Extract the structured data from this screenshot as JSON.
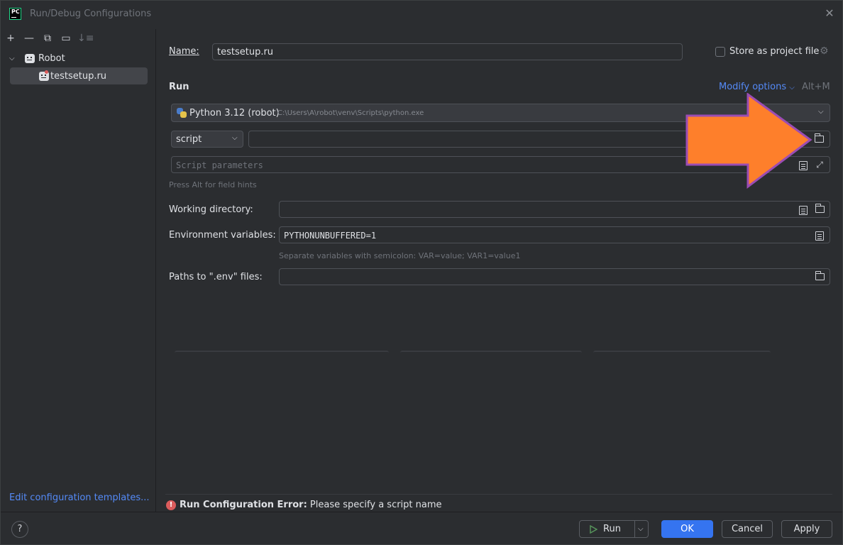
{
  "window": {
    "title": "Run/Debug Configurations",
    "app_logo": "PC"
  },
  "left_panel": {
    "toolbar": [
      "+",
      "—",
      "⧉",
      "▭",
      "↓≡"
    ],
    "tree": {
      "group_label": "Robot",
      "items": [
        {
          "label": "testsetup.ru"
        }
      ]
    },
    "edit_templates_link": "Edit configuration templates..."
  },
  "form": {
    "name_label": "Name:",
    "name_value": "testsetup.ru",
    "store_label": "Store as project file",
    "store_checked": false,
    "run_heading": "Run",
    "modify_options": "Modify options",
    "modify_shortcut": "Alt+M",
    "interpreter_name": "Python 3.12 (robot)",
    "interpreter_path": "C:\\Users\\A\\robot\\venv\\Scripts\\python.exe",
    "script_type": "script",
    "script_path": "",
    "script_params_placeholder": "Script parameters",
    "alt_hint": "Press Alt for field hints",
    "working_dir_label": "Working directory:",
    "working_dir_value": "",
    "env_label": "Environment variables:",
    "env_value": "PYTHONUNBUFFERED=1",
    "env_hint": "Separate variables with semicolon: VAR=value; VAR1=value1",
    "dotenv_label": "Paths to \".env\" files:",
    "dotenv_value": ""
  },
  "error": {
    "title": "Run Configuration Error:",
    "message": "Please specify a script name"
  },
  "buttons": {
    "help": "?",
    "run": "Run",
    "ok": "OK",
    "cancel": "Cancel",
    "apply": "Apply"
  },
  "colors": {
    "accent_blue": "#3574f0",
    "link_blue": "#548af7",
    "error_red": "#db5c5c",
    "annotation_arrow": "#fe7f2b",
    "annotation_arrow_border": "#9b4cb4"
  }
}
